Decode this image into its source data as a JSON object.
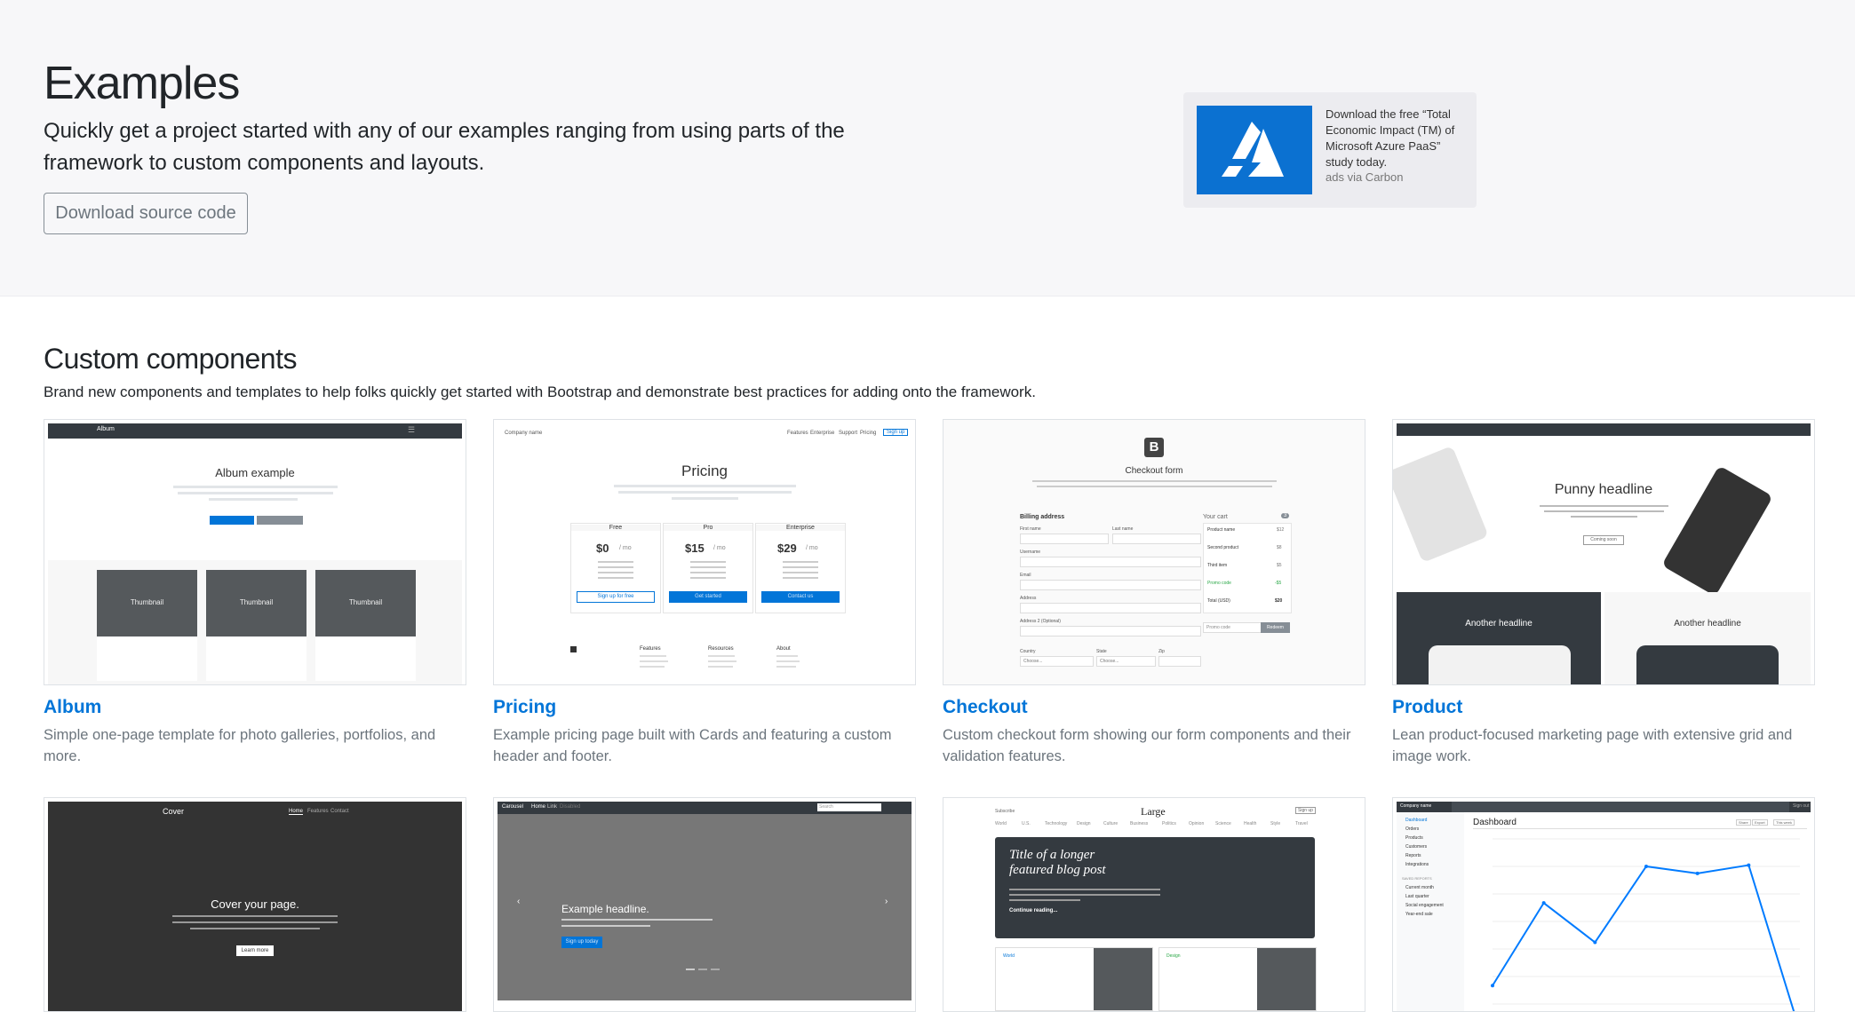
{
  "hero": {
    "title": "Examples",
    "lead": "Quickly get a project started with any of our examples ranging from using parts of the framework to custom components and layouts.",
    "download_label": "Download source code",
    "ad_text": "Download the free “Total Economic Impact (TM) of Microsoft Azure PaaS” study today.",
    "ad_via": "ads via Carbon"
  },
  "section": {
    "title": "Custom components",
    "lead": "Brand new components and templates to help folks quickly get started with Bootstrap and demonstrate best practices for adding onto the framework."
  },
  "cards": [
    {
      "title": "Album",
      "desc": "Simple one-page template for photo galleries, portfolios, and more."
    },
    {
      "title": "Pricing",
      "desc": "Example pricing page built with Cards and featuring a custom header and footer."
    },
    {
      "title": "Checkout",
      "desc": "Custom checkout form showing our form components and their validation features."
    },
    {
      "title": "Product",
      "desc": "Lean product-focused marketing page with extensive grid and image work."
    }
  ],
  "previews": {
    "album": {
      "nav": "Album",
      "heading": "Album example",
      "thumb": "Thumbnail"
    },
    "pricing": {
      "brand": "Company name",
      "nav": [
        "Features",
        "Enterprise",
        "Support",
        "Pricing"
      ],
      "signup": "Sign up",
      "heading": "Pricing",
      "plans": [
        {
          "name": "Free",
          "price": "$0",
          "per": "/ mo",
          "btn": "Sign up for free"
        },
        {
          "name": "Pro",
          "price": "$15",
          "per": "/ mo",
          "btn": "Get started"
        },
        {
          "name": "Enterprise",
          "price": "$29",
          "per": "/ mo",
          "btn": "Contact us"
        }
      ],
      "footer": [
        "Features",
        "Resources",
        "About"
      ]
    },
    "checkout": {
      "logo": "B",
      "heading": "Checkout form",
      "billing": "Billing address",
      "cart": "Your cart",
      "cart_count": "3",
      "fields": [
        "First name",
        "Last name",
        "Username",
        "Email",
        "Address",
        "Address 2 (Optional)"
      ],
      "items": [
        "Product name",
        "Second product",
        "Third item",
        "Promo code",
        "Total (USD)"
      ],
      "prices": [
        "$12",
        "$8",
        "$5",
        "-$5",
        "$20"
      ],
      "promo": "Promo code",
      "redeem": "Redeem",
      "country": "Country",
      "state": "State",
      "zip": "Zip",
      "choose": "Choose..."
    },
    "product": {
      "headline": "Punny headline",
      "cta": "Coming soon",
      "another": "Another headline"
    },
    "cover": {
      "brand": "Cover",
      "nav": [
        "Home",
        "Features",
        "Contact"
      ],
      "heading": "Cover your page.",
      "btn": "Learn more"
    },
    "carousel": {
      "brand": "Carousel",
      "nav": [
        "Home",
        "Link",
        "Disabled"
      ],
      "search": "Search",
      "heading": "Example headline.",
      "btn": "Sign up today"
    },
    "blog": {
      "subscribe": "Subscribe",
      "logo": "Large",
      "signup": "Sign up",
      "title": "Title of a longer featured blog post",
      "continue": "Continue reading...",
      "world": "World",
      "design": "Design",
      "nav": [
        "World",
        "U.S.",
        "Technology",
        "Design",
        "Culture",
        "Business",
        "Politics",
        "Opinion",
        "Science",
        "Health",
        "Style",
        "Travel"
      ]
    },
    "dashboard": {
      "brand": "Company name",
      "signout": "Sign out",
      "title": "Dashboard",
      "share": "Share",
      "export": "Export",
      "week": "This week",
      "menu": [
        "Dashboard",
        "Orders",
        "Products",
        "Customers",
        "Reports",
        "Integrations"
      ],
      "reports": [
        "SAVED REPORTS",
        "Current month",
        "Last quarter",
        "Social engagement",
        "Year-end sale"
      ]
    }
  },
  "chart_data": {
    "type": "line",
    "x": [
      0,
      1,
      2,
      3,
      4,
      5,
      6
    ],
    "y": [
      15339,
      21345,
      18483,
      24003,
      23489,
      24092,
      12034
    ],
    "ylim": [
      14000,
      26000
    ]
  }
}
